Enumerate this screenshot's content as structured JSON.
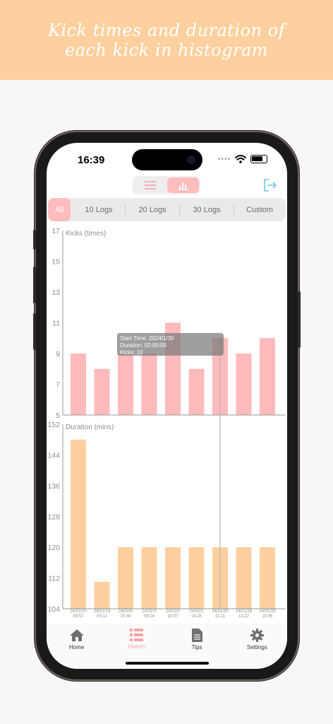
{
  "banner": {
    "text": "Kick times and duration of each kick in histogram"
  },
  "status_bar": {
    "time": "16:39",
    "dots": "••••"
  },
  "filters": [
    {
      "label": "All",
      "active": true
    },
    {
      "label": "10 Logs",
      "active": false
    },
    {
      "label": "20 Logs",
      "active": false
    },
    {
      "label": "30 Logs",
      "active": false
    },
    {
      "label": "Custom",
      "active": false
    }
  ],
  "chart_data": [
    {
      "type": "bar",
      "ylabel": "Kicks (times)",
      "ylim": [
        5,
        17
      ],
      "yticks": [
        "17",
        "15",
        "13",
        "11",
        "9",
        "7",
        "5"
      ],
      "categories": [
        "24/02/20 09:57",
        "24/02/19 09:12",
        "24/02/6 15:40",
        "24/02/3 09:14",
        "24/02/2 10:07",
        "24/02/1 14:25",
        "24/01/30 11:21",
        "24/01/26 13:22",
        "24/01/25 10:45"
      ],
      "values": [
        9,
        8,
        9,
        9,
        11,
        8,
        10,
        9,
        10
      ],
      "color": "#ffbabc"
    },
    {
      "type": "bar",
      "ylabel": "Duration (mins)",
      "ylim": [
        104,
        152
      ],
      "yticks": [
        "152",
        "144",
        "136",
        "128",
        "120",
        "112",
        "104"
      ],
      "categories": [
        "24/02/20 09:57",
        "24/02/19 09:12",
        "24/02/6 15:40",
        "24/02/3 09:14",
        "24/02/2 10:07",
        "24/02/1 14:25",
        "24/01/30 11:21",
        "24/01/26 13:22",
        "24/01/25 10:45"
      ],
      "x_labels": [
        [
          "24/02/20",
          "09:57"
        ],
        [
          "24/02/19",
          "09:12"
        ],
        [
          "24/02/6",
          "15:40"
        ],
        [
          "24/02/3",
          "09:14"
        ],
        [
          "24/02/2",
          "10:07"
        ],
        [
          "24/02/1",
          "14:25"
        ],
        [
          "24/01/30",
          "11:21"
        ],
        [
          "24/01/26",
          "13:22"
        ],
        [
          "24/01/25",
          "10:45"
        ]
      ],
      "values": [
        148,
        111,
        120,
        120,
        120,
        120,
        120,
        120,
        120
      ],
      "color": "#fed09f"
    }
  ],
  "tooltip": {
    "selected_index": 6,
    "lines": [
      "Start Time:  2024/1/30",
      "Duration:  02:00:00",
      "Kicks:  10"
    ]
  },
  "tabs": [
    {
      "label": "Home",
      "icon": "house-icon",
      "active": false
    },
    {
      "label": "History",
      "icon": "list-icon",
      "active": true
    },
    {
      "label": "Tips",
      "icon": "document-icon",
      "active": false
    },
    {
      "label": "Settings",
      "icon": "gear-icon",
      "active": false
    }
  ],
  "colors": {
    "accent_pink": "#ffbcbd",
    "accent_orange": "#fed09f",
    "inactive_tab": "#333333"
  }
}
